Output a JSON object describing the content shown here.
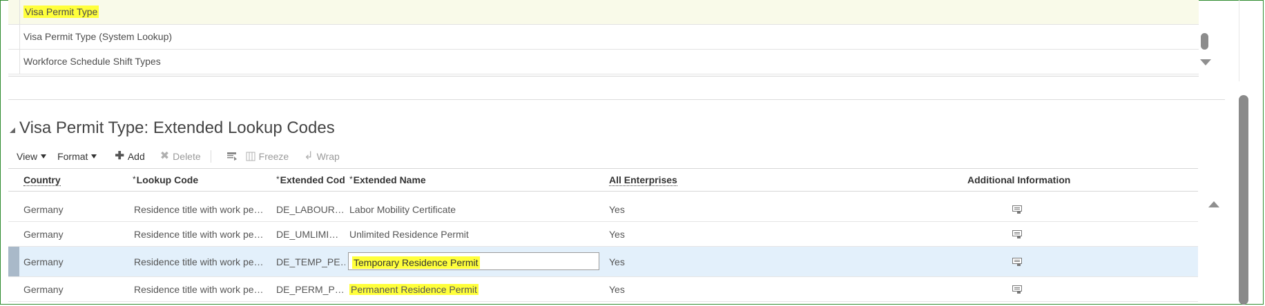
{
  "lookup_list": {
    "items": [
      {
        "label": "Visa Permit Type",
        "selected": true
      },
      {
        "label": "Visa Permit Type (System Lookup)",
        "selected": false
      },
      {
        "label": "Workforce Schedule Shift Types",
        "selected": false
      }
    ]
  },
  "section": {
    "title": "Visa Permit Type: Extended Lookup Codes"
  },
  "toolbar": {
    "view_label": "View",
    "format_label": "Format",
    "add_label": "Add",
    "delete_label": "Delete",
    "freeze_label": "Freeze",
    "wrap_label": "Wrap"
  },
  "table": {
    "columns": {
      "country": "Country",
      "lookup_code": "Lookup Code",
      "extended_code": "Extended Cod",
      "extended_name": "Extended Name",
      "all_enterprises": "All Enterprises",
      "additional_info": "Additional Information"
    },
    "rows": [
      {
        "country": "Germany",
        "lookup_code": "Residence title with work pe…",
        "extended_code": "DE_LABOUR…",
        "extended_name": "Labor Mobility Certificate",
        "all_enterprises": "Yes"
      },
      {
        "country": "Germany",
        "lookup_code": "Residence title with work pe…",
        "extended_code": "DE_UMLIMI…",
        "extended_name": "Unlimited Residence Permit",
        "all_enterprises": "Yes"
      },
      {
        "country": "Germany",
        "lookup_code": "Residence title with work pe…",
        "extended_code": "DE_TEMP_PE…",
        "extended_name": "Temporary Residence Permit",
        "all_enterprises": "Yes"
      },
      {
        "country": "Germany",
        "lookup_code": "Residence title with work pe…",
        "extended_code": "DE_PERM_P…",
        "extended_name": "Permanent Residence Permit",
        "all_enterprises": "Yes"
      }
    ]
  },
  "colors": {
    "highlight": "#ffff3b",
    "selected_row": "#e3f0fb",
    "frame_border": "#2e8b2e"
  }
}
